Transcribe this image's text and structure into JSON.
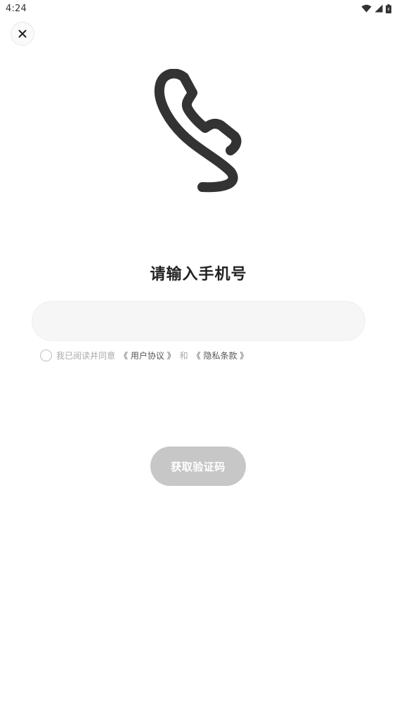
{
  "status_bar": {
    "time": "4:24",
    "icons": [
      "wifi-icon",
      "cellular-signal-icon",
      "battery-icon"
    ]
  },
  "close_button": {
    "icon": "close-icon"
  },
  "illustration": {
    "icon": "phone-handset-icon",
    "color": "#333333"
  },
  "title": "请输入手机号",
  "phone_input": {
    "value": "",
    "placeholder": ""
  },
  "agreement": {
    "prefix": "我已阅读并同意",
    "user_agreement": "《 用户协议 》",
    "connector": "和",
    "privacy_policy": "《 隐私条款 》",
    "checked": false
  },
  "get_code_button": {
    "label": "获取验证码",
    "background": "#c7c7c7"
  }
}
